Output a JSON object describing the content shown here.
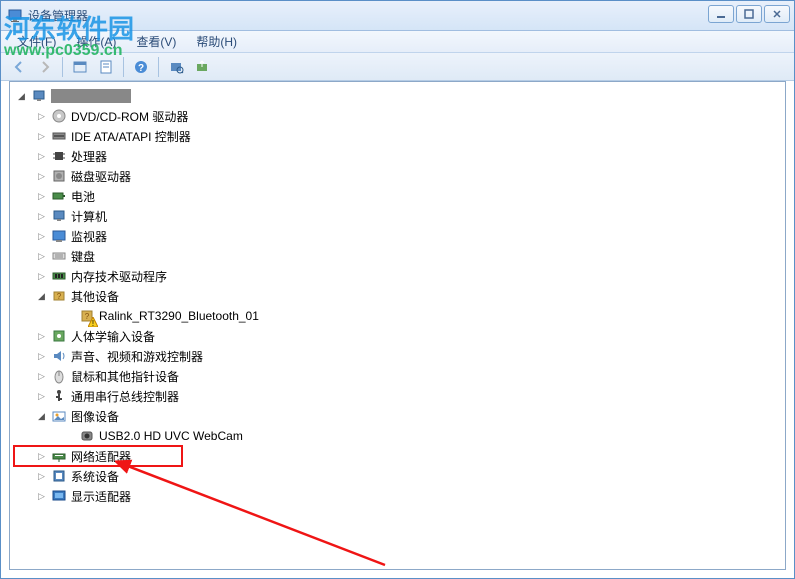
{
  "watermark": {
    "main": "河东软件园",
    "url": "www.pc0359.cn"
  },
  "window": {
    "title": "设备管理器"
  },
  "menu": {
    "file": "文件(F)",
    "action": "操作(A)",
    "view": "查看(V)",
    "help": "帮助(H)"
  },
  "tree": {
    "root": "",
    "items": [
      {
        "label": "DVD/CD-ROM 驱动器",
        "icon": "dvd",
        "expand": "closed"
      },
      {
        "label": "IDE ATA/ATAPI 控制器",
        "icon": "ide",
        "expand": "closed"
      },
      {
        "label": "处理器",
        "icon": "cpu",
        "expand": "closed"
      },
      {
        "label": "磁盘驱动器",
        "icon": "disk",
        "expand": "closed"
      },
      {
        "label": "电池",
        "icon": "battery",
        "expand": "closed"
      },
      {
        "label": "计算机",
        "icon": "computer",
        "expand": "closed"
      },
      {
        "label": "监视器",
        "icon": "monitor",
        "expand": "closed"
      },
      {
        "label": "键盘",
        "icon": "keyboard",
        "expand": "closed"
      },
      {
        "label": "内存技术驱动程序",
        "icon": "memory",
        "expand": "closed"
      },
      {
        "label": "其他设备",
        "icon": "other",
        "expand": "open",
        "children": [
          {
            "label": "Ralink_RT3290_Bluetooth_01",
            "icon": "unknown-warn"
          }
        ]
      },
      {
        "label": "人体学输入设备",
        "icon": "hid",
        "expand": "closed"
      },
      {
        "label": "声音、视频和游戏控制器",
        "icon": "sound",
        "expand": "closed"
      },
      {
        "label": "鼠标和其他指针设备",
        "icon": "mouse",
        "expand": "closed"
      },
      {
        "label": "通用串行总线控制器",
        "icon": "usb",
        "expand": "closed"
      },
      {
        "label": "图像设备",
        "icon": "image",
        "expand": "open",
        "children": [
          {
            "label": "USB2.0 HD UVC WebCam",
            "icon": "webcam"
          }
        ]
      },
      {
        "label": "网络适配器",
        "icon": "network",
        "expand": "closed",
        "highlighted": true
      },
      {
        "label": "系统设备",
        "icon": "system",
        "expand": "closed"
      },
      {
        "label": "显示适配器",
        "icon": "display",
        "expand": "closed"
      }
    ]
  }
}
